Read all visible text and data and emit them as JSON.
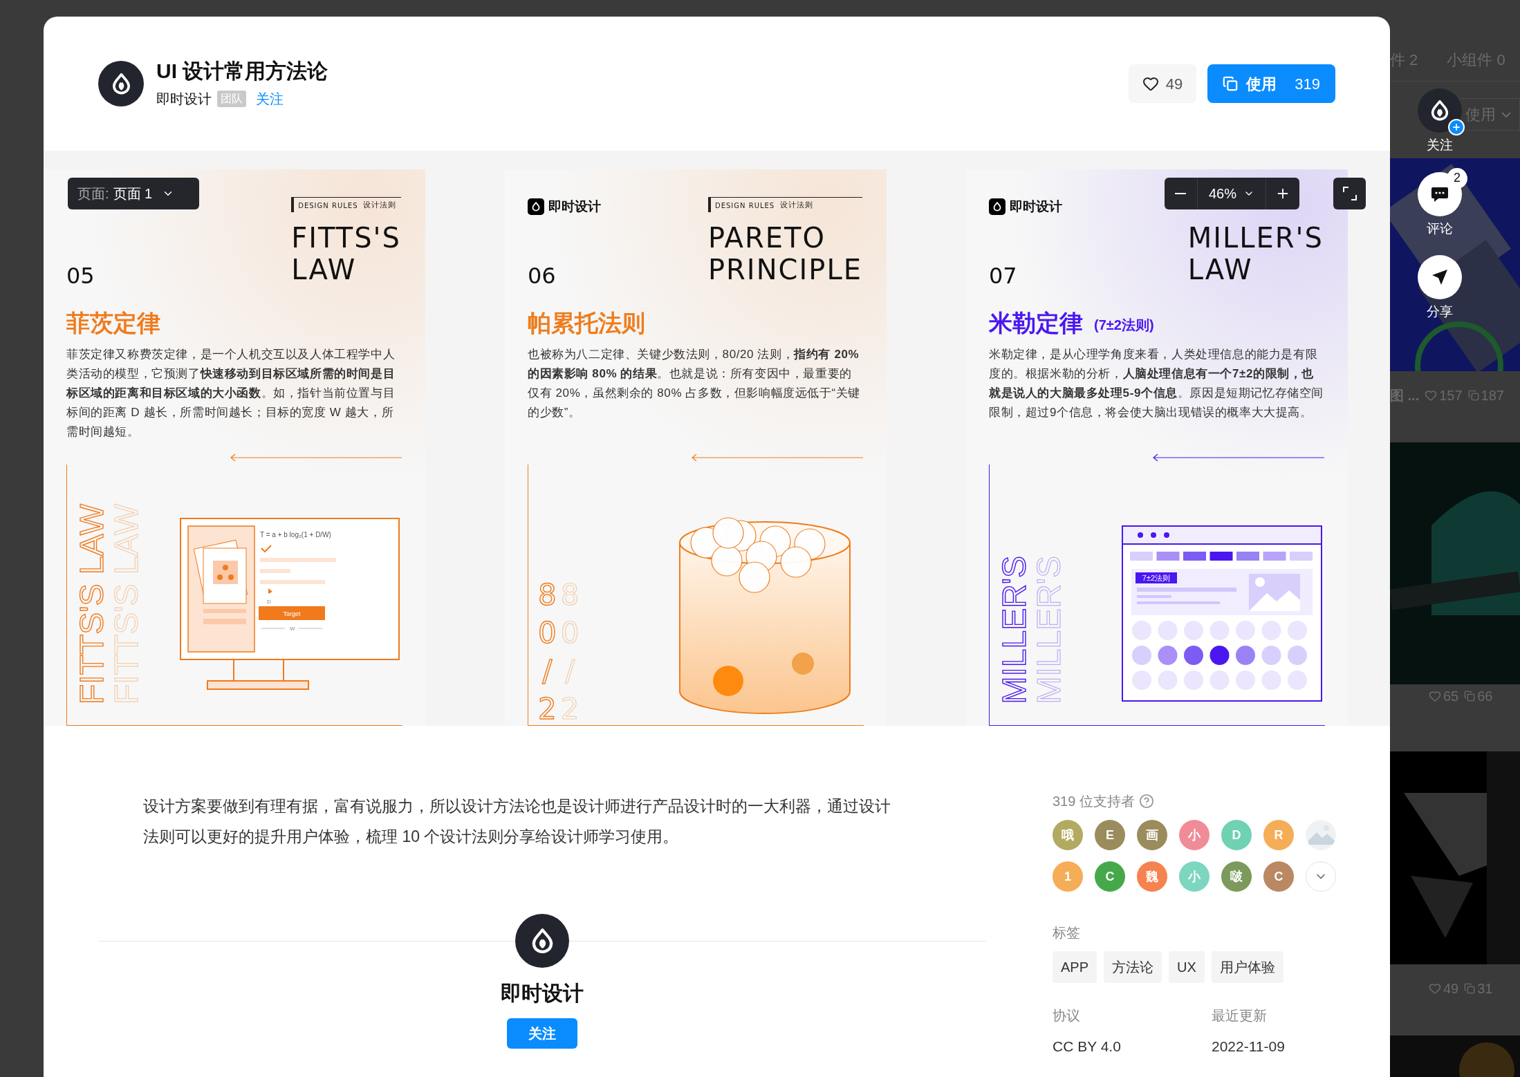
{
  "header": {
    "title": "UI 设计常用方法论",
    "author": "即时设计",
    "author_badge": "团队",
    "follow_label": "关注",
    "likes": "49",
    "use_label": "使用",
    "use_count": "319"
  },
  "page_select": {
    "label": "页面:",
    "value": "页面 1"
  },
  "zoom": {
    "value": "46%"
  },
  "cards": [
    {
      "kind": "fitts",
      "color": "#f07a1c",
      "tag": "DESIGN RULES",
      "tag_cn": "设计法则",
      "en_title": [
        "FITTS'S",
        "LAW"
      ],
      "number": "05",
      "cn_title": "菲茨定律",
      "body": "菲茨定律又称费茨定律，是一个人机交互以及人体工程学中人类活动的模型，它预测了**快速移动到目标区域所需的时间是目标区域的距离和目标区域的大小函数**。如，指针当前位置与目标间的距离 D 越长，所需时间越长；目标的宽度 W 越大，所需时间越短。",
      "vertical_texts": [
        "FITTS'S LAW",
        "FITTS'S LAW"
      ],
      "art_texts": [
        "T = a + b log₂(1 + D/W)",
        "D",
        "Target",
        "W"
      ]
    },
    {
      "kind": "pareto",
      "color": "#ee7d1e",
      "brand": "即时设计",
      "tag": "DESIGN RULES",
      "tag_cn": "设计法则",
      "en_title": [
        "PARETO",
        "PRINCIPLE"
      ],
      "number": "06",
      "cn_title": "帕累托法则",
      "body": "也被称为八二定律、关键少数法则，80/20 法则，**指约有 20% 的因素影响 80% 的结果**。也就是说：所有变因中，最重要的仅有 20%，虽然剩余的 80% 占多数，但影响幅度远低于“关键的少数”。",
      "vertical_texts": [
        "80/2",
        "80/2"
      ]
    },
    {
      "kind": "miller",
      "color": "#4a17f0",
      "brand": "即时设计",
      "en_title": [
        "MILLER'S",
        "LAW"
      ],
      "number": "07",
      "cn_title": "米勒定律",
      "cn_sub": "(7±2法则)",
      "body": "米勒定律，是从心理学角度来看，人类处理信息的能力是有限度的。根据米勒的分析，**人脑处理信息有一个7±2的限制，也就是说人的大脑最多处理5-9个信息**。原因是短期记忆存储空间限制，超过9个信息，将会使大脑出现错误的概率大大提高。",
      "vertical_texts": [
        "MILLER'S",
        "MILLER'S"
      ],
      "art_texts": [
        "7±2法则"
      ]
    }
  ],
  "description": "设计方案要做到有理有据，富有说服力，所以设计方法论也是设计师进行产品设计时的一大利器，通过设计法则可以更好的提升用户体验，梳理 10 个设计法则分享给设计师学习使用。",
  "author_block": {
    "name": "即时设计",
    "follow_label": "关注"
  },
  "supporters": {
    "title": "319 位支持者",
    "avatars": [
      {
        "kind": "letter",
        "text": "哦",
        "color": "#b3aa62"
      },
      {
        "kind": "letter",
        "text": "E",
        "color": "#9a8c5c"
      },
      {
        "kind": "letter",
        "text": "画",
        "color": "#9a8c5c"
      },
      {
        "kind": "letter",
        "text": "小",
        "color": "#f08c98"
      },
      {
        "kind": "letter",
        "text": "D",
        "color": "#6fd2b2"
      },
      {
        "kind": "letter",
        "text": "R",
        "color": "#f5ad57"
      },
      {
        "kind": "picture"
      },
      {
        "kind": "letter",
        "text": "1",
        "color": "#f5ad57"
      },
      {
        "kind": "letter",
        "text": "C",
        "color": "#45a94b"
      },
      {
        "kind": "letter",
        "text": "魏",
        "color": "#f5824f"
      },
      {
        "kind": "letter",
        "text": "小",
        "color": "#7cd6c0"
      },
      {
        "kind": "letter",
        "text": "啵",
        "color": "#7b9a5c"
      },
      {
        "kind": "letter",
        "text": "C",
        "color": "#ba8862"
      }
    ]
  },
  "tags": {
    "title": "标签",
    "items": [
      "APP",
      "方法论",
      "UX",
      "用户体验"
    ]
  },
  "meta": [
    {
      "label": "协议",
      "value": "CC BY 4.0"
    },
    {
      "label": "最近更新",
      "value": "2022-11-09"
    }
  ],
  "side_actions": [
    {
      "kind": "follow",
      "label": "关注"
    },
    {
      "kind": "comment",
      "label": "评论",
      "badge": "2"
    },
    {
      "kind": "share",
      "label": "分享"
    }
  ],
  "background": {
    "tabs": [
      "件 2",
      "小组件 0"
    ],
    "sort": "使用",
    "cards": [
      {
        "caption": "图 ...",
        "likes": "157",
        "uses": "187"
      },
      {
        "likes": "65",
        "uses": "66"
      },
      {
        "likes": "49",
        "uses": "31"
      }
    ]
  }
}
